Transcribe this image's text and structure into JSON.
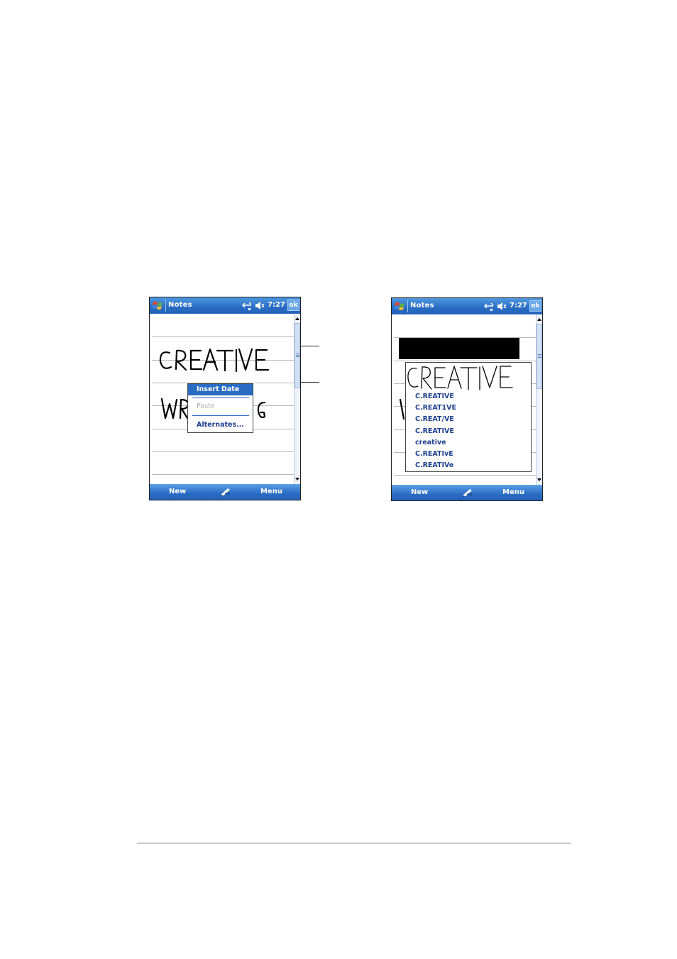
{
  "screens": [
    {
      "title": "Notes",
      "clock": "7:27",
      "ok_label": "ok",
      "cmd_left": "New",
      "cmd_right": "Menu",
      "context_menu": {
        "items": [
          {
            "label": "Insert Date",
            "state": "selected"
          },
          {
            "label": "Paste",
            "state": "disabled"
          },
          {
            "label": "Alternates...",
            "state": "normal"
          }
        ]
      }
    },
    {
      "title": "Notes",
      "clock": "7:27",
      "ok_label": "ok",
      "cmd_left": "New",
      "cmd_right": "Menu",
      "alternates": [
        "C.REATIVE",
        "C.REAT1VE",
        "C.REAT/VE",
        "C.REATIVE",
        "creative",
        "C.REATIvE",
        "C.REATIVe"
      ]
    }
  ],
  "icons": {
    "start": "windows-flag-icon",
    "connectivity": "connectivity-icon",
    "volume": "speaker-muted-icon",
    "input": "pen-input-icon"
  },
  "colors": {
    "titlebar": "#2a6cc3",
    "highlight": "#2a6cc3",
    "text_link": "#1c3f8f"
  }
}
